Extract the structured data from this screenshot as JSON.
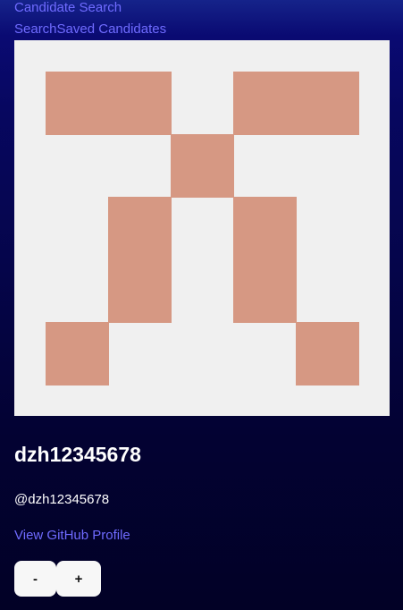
{
  "nav": {
    "title": "Candidate Search",
    "search_link": "Search",
    "saved_link": "Saved Candidates"
  },
  "candidate": {
    "avatar_alt": "identicon avatar",
    "avatar_colors": {
      "background": "#f0f0f0",
      "foreground": "#d69883"
    },
    "username": "dzh12345678",
    "handle": "@dzh12345678",
    "profile_link": "View GitHub Profile"
  },
  "actions": {
    "reject_label": "-",
    "accept_label": "+"
  },
  "colors": {
    "link": "#6f6bff",
    "text": "#ffffff",
    "button_bg": "#f7f7f7"
  }
}
